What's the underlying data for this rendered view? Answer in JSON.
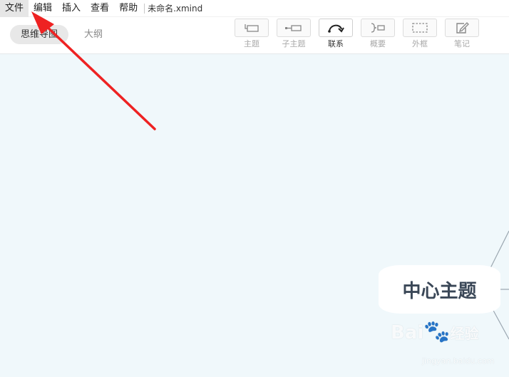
{
  "menubar": {
    "items": [
      "文件",
      "编辑",
      "插入",
      "查看",
      "帮助"
    ],
    "document_title": "未命名.xmind"
  },
  "view_tabs": {
    "mindmap": "思维导图",
    "outline": "大纲"
  },
  "tools": {
    "topic": "主题",
    "subtopic": "子主题",
    "relationship": "联系",
    "summary": "概要",
    "boundary": "外框",
    "note": "笔记"
  },
  "canvas": {
    "central_topic": "中心主题"
  },
  "watermark": {
    "brand": "Bai",
    "brand_suffix": "经验",
    "url": "jingyan.baidu.com"
  },
  "annotation": {
    "arrow_color": "#ee2222"
  },
  "colors": {
    "canvas_bg": "#f0f8fb",
    "central_text": "#3a4757"
  }
}
